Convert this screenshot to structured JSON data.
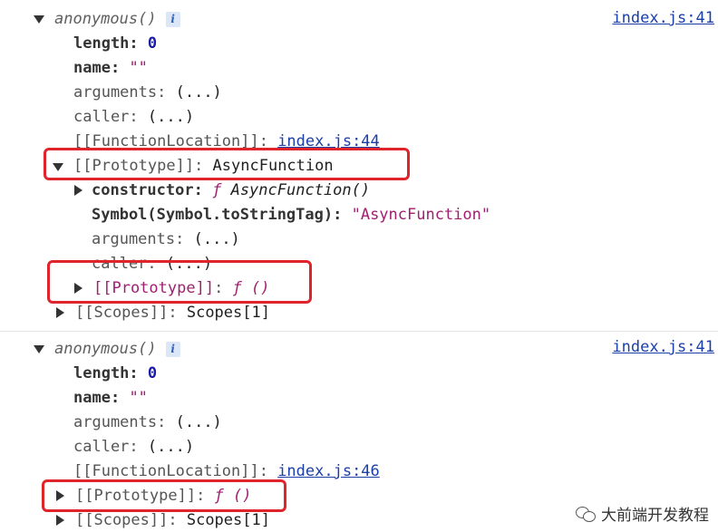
{
  "entries": [
    {
      "title": "anonymous()",
      "info_label": "i",
      "source_link": "index.js:41",
      "length_key": "length",
      "length_value": "0",
      "name_key": "name",
      "name_value": "\"\"",
      "arguments_key": "arguments",
      "arguments_value": "(...)",
      "caller_key": "caller",
      "caller_value": "(...)",
      "function_location_key": "[[FunctionLocation]]",
      "function_location_link": "index.js:44",
      "prototype_key": "[[Prototype]]",
      "prototype_value": "AsyncFunction",
      "proto_children": {
        "constructor_key": "constructor",
        "constructor_f": "ƒ",
        "constructor_value": "AsyncFunction()",
        "symbol_key": "Symbol(Symbol.toStringTag)",
        "symbol_value": "\"AsyncFunction\"",
        "arguments_key": "arguments",
        "arguments_value": "(...)",
        "caller_key": "caller",
        "caller_value": "(...)",
        "prototype_key": "[[Prototype]]",
        "prototype_f": "ƒ",
        "prototype_value": "()"
      },
      "scopes_key": "[[Scopes]]",
      "scopes_value": "Scopes[1]"
    },
    {
      "title": "anonymous()",
      "info_label": "i",
      "source_link": "index.js:41",
      "length_key": "length",
      "length_value": "0",
      "name_key": "name",
      "name_value": "\"\"",
      "arguments_key": "arguments",
      "arguments_value": "(...)",
      "caller_key": "caller",
      "caller_value": "(...)",
      "function_location_key": "[[FunctionLocation]]",
      "function_location_link": "index.js:46",
      "prototype_key": "[[Prototype]]",
      "prototype_f": "ƒ",
      "prototype_value": "()",
      "scopes_key": "[[Scopes]]",
      "scopes_value": "Scopes[1]"
    }
  ],
  "watermark": {
    "text": "大前端开发教程",
    "icon": "wechat-icon"
  },
  "colors": {
    "highlight": "#e0242b",
    "link": "#1a3fa8",
    "string": "#a01f70",
    "number": "#1a1aa6"
  }
}
